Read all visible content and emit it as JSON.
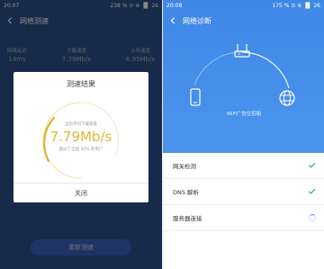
{
  "left": {
    "status": {
      "time": "20:07",
      "right": "238 % ⊙ ≋ ▐▌ 26"
    },
    "title": "网络测速",
    "stats": [
      {
        "label": "网络延迟",
        "value": "14ms"
      },
      {
        "label": "下载速度",
        "value": "7.79Mb/s"
      },
      {
        "label": "上传速度",
        "value": "6.95Mb/s"
      }
    ],
    "dialog": {
      "title": "测速结果",
      "gauge_label": "当前平均下载速度",
      "speed": "7.79Mb/s",
      "note": "超过了全国 32% 的用户",
      "close": "关闭"
    },
    "retest": "重新测速"
  },
  "right": {
    "status": {
      "time": "20:08",
      "right": "175 % ⊙ ≋ ▐▌ 26"
    },
    "title": "网络诊断",
    "wifi": "WiFi广告位招租",
    "checks": [
      {
        "label": "网关检测",
        "state": "done"
      },
      {
        "label": "DNS 解析",
        "state": "done"
      },
      {
        "label": "服务器连接",
        "state": "loading"
      }
    ]
  },
  "colors": {
    "check": "#2bb673",
    "accent": "#4b8ff0",
    "gauge": "#e0b733"
  }
}
